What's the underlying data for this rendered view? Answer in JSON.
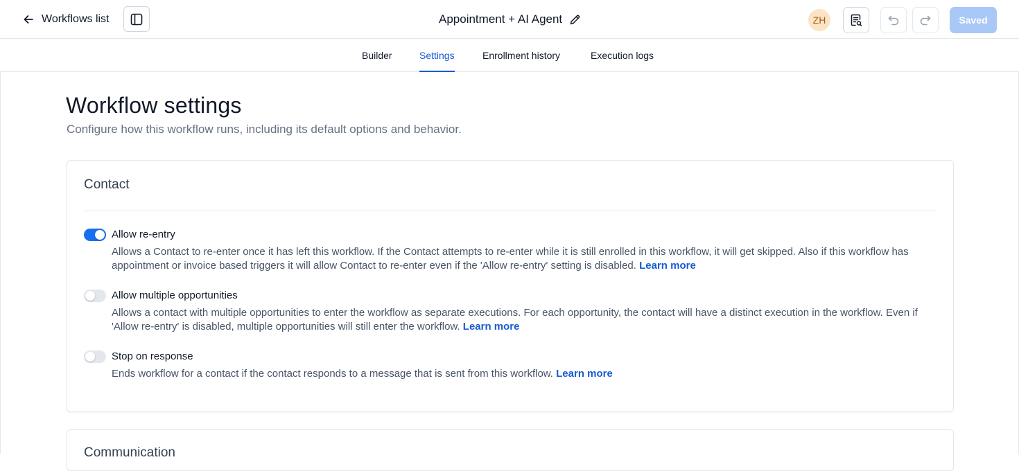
{
  "header": {
    "back_label": "Workflows list",
    "workflow_title": "Appointment + AI Agent",
    "avatar_initials": "ZH",
    "saved_label": "Saved"
  },
  "tabs": [
    {
      "label": "Builder",
      "active": false
    },
    {
      "label": "Settings",
      "active": true
    },
    {
      "label": "Enrollment history",
      "active": false
    },
    {
      "label": "Execution logs",
      "active": false
    }
  ],
  "page": {
    "title": "Workflow settings",
    "subtitle": "Configure how this workflow runs, including its default options and behavior."
  },
  "contact_section": {
    "title": "Contact",
    "settings": [
      {
        "label": "Allow re-entry",
        "enabled": true,
        "description": "Allows a Contact to re-enter once it has left this workflow. If the Contact attempts to re-enter while it is still enrolled in this workflow, it will get skipped. Also if this workflow has appointment or invoice based triggers it will allow Contact to re-enter even if the 'Allow re-entry' setting is disabled.",
        "link": "Learn more"
      },
      {
        "label": "Allow multiple opportunities",
        "enabled": false,
        "description": "Allows a contact with multiple opportunities to enter the workflow as separate executions. For each opportunity, the contact will have a distinct execution in the workflow. Even if 'Allow re-entry' is disabled, multiple opportunities will still enter the workflow.",
        "link": "Learn more"
      },
      {
        "label": "Stop on response",
        "enabled": false,
        "description": "Ends workflow for a contact if the contact responds to a message that is sent from this workflow.",
        "link": "Learn more"
      }
    ]
  },
  "communication_section": {
    "title": "Communication"
  },
  "colors": {
    "accent": "#175cd3",
    "toggle_on": "#1570ef",
    "saved_button": "#a9c7f7",
    "avatar_bg": "#fbe4c4"
  },
  "icons": {
    "back": "arrow-left-icon",
    "panel": "sidebar-panel-icon",
    "edit": "pencil-icon",
    "notes": "notes-icon",
    "undo": "undo-icon",
    "redo": "redo-icon"
  }
}
